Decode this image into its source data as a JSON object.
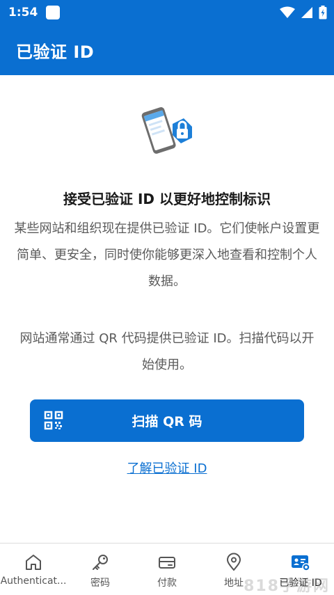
{
  "status_bar": {
    "time": "1:54"
  },
  "app_bar": {
    "title": "已验证 ID"
  },
  "content": {
    "headline": "接受已验证 ID 以更好地控制标识",
    "paragraph1": "某些网站和组织现在提供已验证 ID。它们使帐户设置更简单、更安全，同时使你能够更深入地查看和控制个人数据。",
    "paragraph2": "网站通常通过 QR 代码提供已验证 ID。扫描代码以开始使用。",
    "scan_button": "扫描 QR 码",
    "learn_link": "了解已验证 ID"
  },
  "bottom_nav": [
    {
      "label": "Authenticat...",
      "icon": "home-icon"
    },
    {
      "label": "密码",
      "icon": "key-icon"
    },
    {
      "label": "付款",
      "icon": "card-icon"
    },
    {
      "label": "地址",
      "icon": "location-icon"
    },
    {
      "label": "已验证 ID",
      "icon": "verified-id-icon",
      "active": true
    }
  ],
  "watermark": "818手游网",
  "colors": {
    "primary": "#0a6fd1"
  }
}
